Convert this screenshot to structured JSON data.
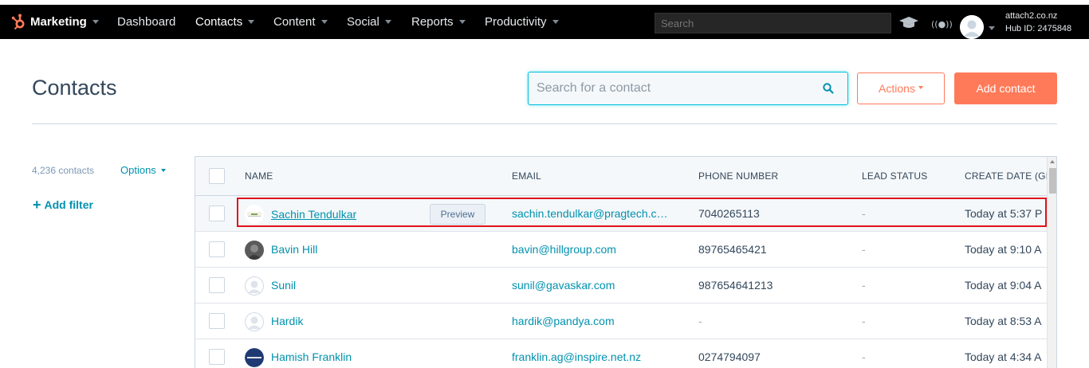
{
  "topnav": {
    "brand": "Marketing",
    "items": [
      {
        "label": "Dashboard",
        "has_caret": false
      },
      {
        "label": "Contacts",
        "has_caret": true,
        "active": true
      },
      {
        "label": "Content",
        "has_caret": true
      },
      {
        "label": "Social",
        "has_caret": true
      },
      {
        "label": "Reports",
        "has_caret": true
      },
      {
        "label": "Productivity",
        "has_caret": true
      }
    ],
    "search_placeholder": "Search",
    "account_name": "attach2.co.nz",
    "hub_id": "Hub ID: 2475848",
    "icons": [
      "sprocket-logo-icon",
      "graduation-cap-icon",
      "broadcast-icon",
      "user-avatar-icon"
    ]
  },
  "header": {
    "title": "Contacts",
    "search_placeholder": "Search for a contact",
    "actions_label": "Actions",
    "add_contact_label": "Add contact"
  },
  "sidebar": {
    "contact_count": "4,236 contacts",
    "options_label": "Options",
    "add_filter_label": "Add filter"
  },
  "table": {
    "columns": [
      "NAME",
      "EMAIL",
      "PHONE NUMBER",
      "LEAD STATUS",
      "CREATE DATE (GMT"
    ],
    "rows": [
      {
        "name": "Sachin Tendulkar",
        "email": "sachin.tendulkar@pragtech.c…",
        "phone": "7040265113",
        "lead_status": "-",
        "create_date": "Today at 5:37 P",
        "avatar": "company-logo-icon",
        "preview_label": "Preview",
        "highlighted": true
      },
      {
        "name": "Bavin Hill",
        "email": "bavin@hillgroup.com",
        "phone": "89765465421",
        "lead_status": "-",
        "create_date": "Today at 9:10 A",
        "avatar": "photo-avatar-icon"
      },
      {
        "name": "Sunil",
        "email": "sunil@gavaskar.com",
        "phone": "987654641213",
        "lead_status": "-",
        "create_date": "Today at 9:04 A",
        "avatar": "default-avatar-icon"
      },
      {
        "name": "Hardik",
        "email": "hardik@pandya.com",
        "phone": "-",
        "lead_status": "-",
        "create_date": "Today at 8:53 A",
        "avatar": "default-avatar-icon"
      },
      {
        "name": "Hamish Franklin",
        "email": "franklin.ag@inspire.net.nz",
        "phone": "0274794097",
        "lead_status": "-",
        "create_date": "Today at 4:34 A",
        "avatar": "inspire-logo-icon"
      }
    ]
  },
  "colors": {
    "accent": "#ff7a59",
    "link": "#0091ae",
    "text": "#33475b",
    "highlight_border": "#e0121b",
    "search_focus": "#00bfdd"
  }
}
